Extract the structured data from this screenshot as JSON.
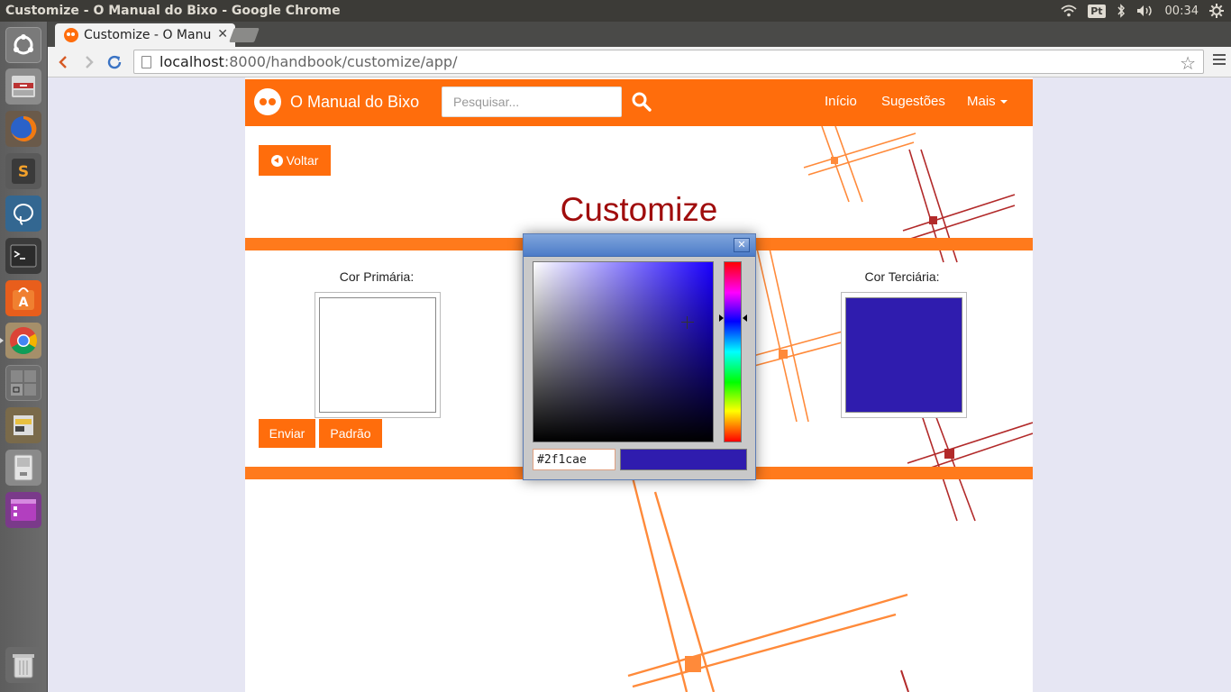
{
  "window": {
    "title": "Customize - O Manual do Bixo - Google Chrome"
  },
  "system_tray": {
    "keyboard_layout": "Pt",
    "clock": "00:34"
  },
  "launcher": {
    "items": [
      "dash-home",
      "file-manager",
      "firefox",
      "sublime-text",
      "postgresql-elephant",
      "terminal",
      "ubuntu-software-center",
      "chrome",
      "workspace-switcher",
      "dialog-app",
      "drive",
      "app-launcher",
      "trash"
    ]
  },
  "browser": {
    "tab_title": "Customize - O Manu",
    "url_host": "localhost",
    "url_path": ":8000/handbook/customize/app/"
  },
  "navbar": {
    "brand": "O Manual do Bixo",
    "search_placeholder": "Pesquisar...",
    "links": {
      "inicio": "Início",
      "sugestoes": "Sugestões",
      "mais": "Mais"
    }
  },
  "main": {
    "back_label": "Voltar",
    "heading": "Customize",
    "primary_label": "Cor Primária:",
    "tertiary_label": "Cor Terciária:",
    "submit_label": "Enviar",
    "default_label": "Padrão"
  },
  "picker": {
    "close": "✕",
    "hex_value": "#2f1cae"
  },
  "colors": {
    "brand_orange": "#ff6d0c",
    "stripe_orange": "#ff7a1c",
    "heading_red": "#a00d0d",
    "primary_color": "#ffffff",
    "tertiary_color": "#2f1cae",
    "page_background": "#e6e6f3"
  }
}
